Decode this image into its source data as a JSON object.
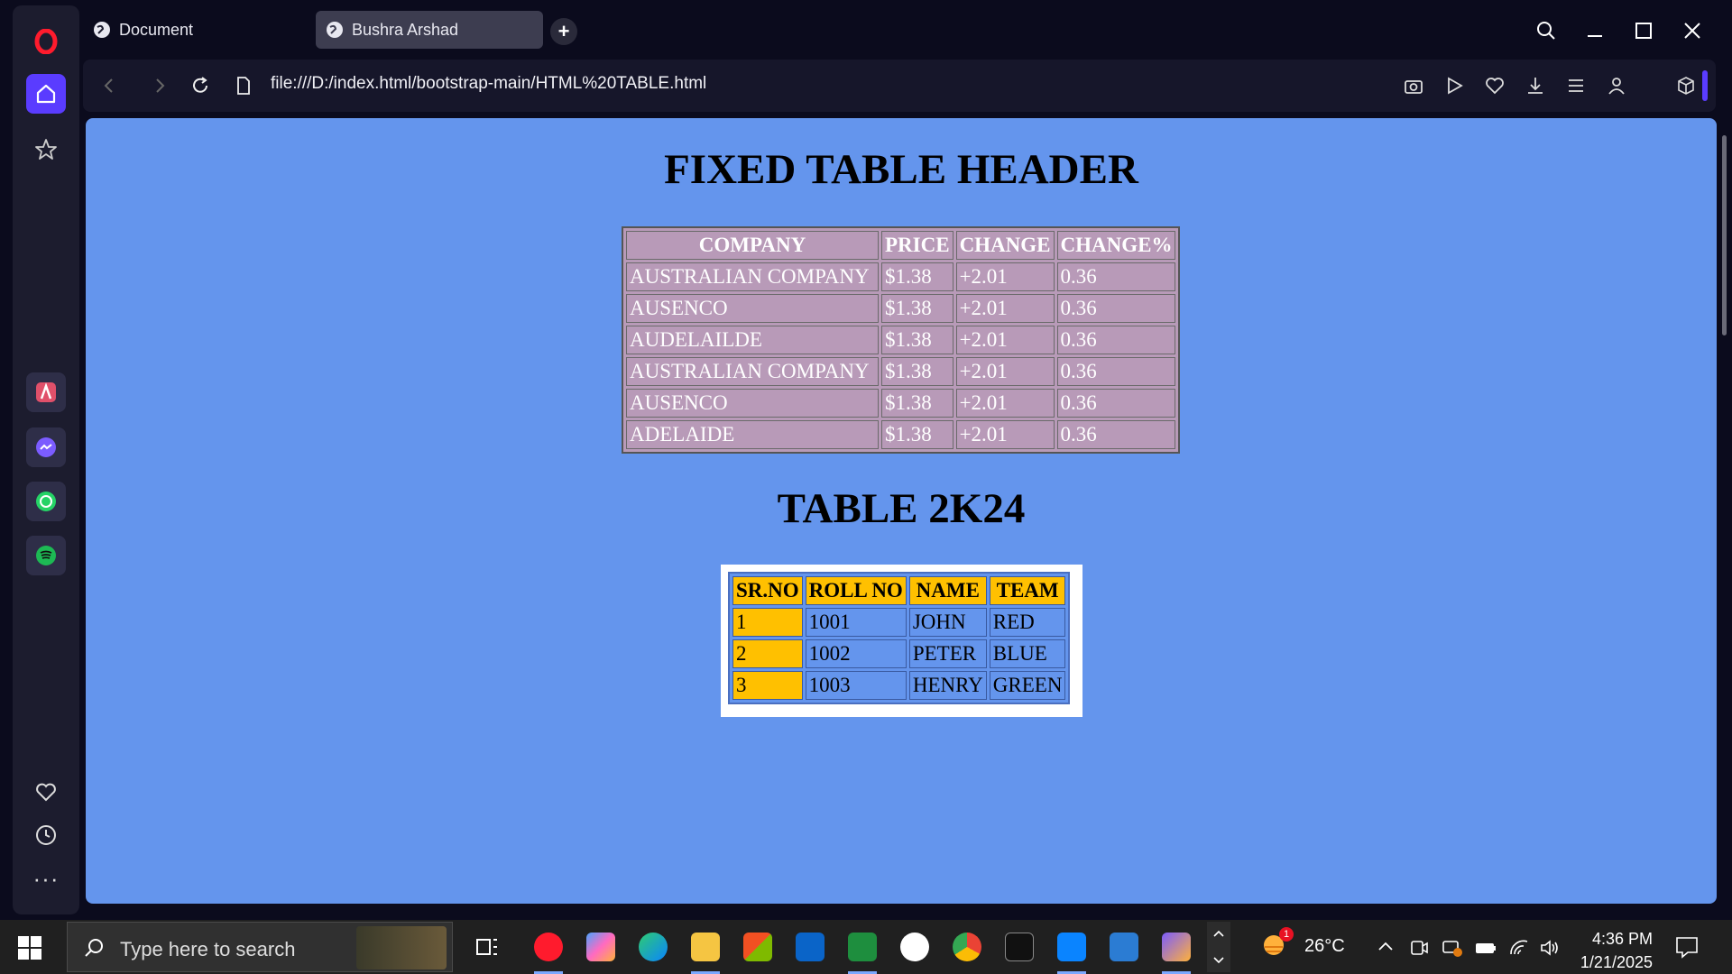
{
  "browser": {
    "tabs": [
      {
        "label": "Document"
      },
      {
        "label": "Bushra Arshad"
      }
    ],
    "url": "file:///D:/index.html/bootstrap-main/HTML%20TABLE.html"
  },
  "page": {
    "heading1": "FIXED TABLE HEADER",
    "table1": {
      "headers": [
        "COMPANY",
        "PRICE",
        "CHANGE",
        "CHANGE%"
      ],
      "rows": [
        [
          "AUSTRALIAN COMPANY",
          "$1.38",
          "+2.01",
          "0.36"
        ],
        [
          "AUSENCO",
          "$1.38",
          "+2.01",
          "0.36"
        ],
        [
          "AUDELAILDE",
          "$1.38",
          "+2.01",
          "0.36"
        ],
        [
          "AUSTRALIAN COMPANY",
          "$1.38",
          "+2.01",
          "0.36"
        ],
        [
          "AUSENCO",
          "$1.38",
          "+2.01",
          "0.36"
        ],
        [
          "ADELAIDE",
          "$1.38",
          "+2.01",
          "0.36"
        ]
      ]
    },
    "heading2": "TABLE 2K24",
    "table2": {
      "headers": [
        "SR.NO",
        "ROLL NO",
        "NAME",
        "TEAM"
      ],
      "rows": [
        [
          "1",
          "1001",
          "JOHN",
          "RED"
        ],
        [
          "2",
          "1002",
          "PETER",
          "BLUE"
        ],
        [
          "3",
          "1003",
          "HENRY",
          "GREEN"
        ]
      ]
    }
  },
  "taskbar": {
    "search_placeholder": "Type here to search",
    "weather": "26°C",
    "weather_badge": "1",
    "time": "4:36 PM",
    "date": "1/21/2025"
  },
  "colors": {
    "page_bg": "#6495ed",
    "table1_bg": "#b89ab8",
    "table2_header": "#ffc000",
    "accent": "#5a3cff"
  }
}
